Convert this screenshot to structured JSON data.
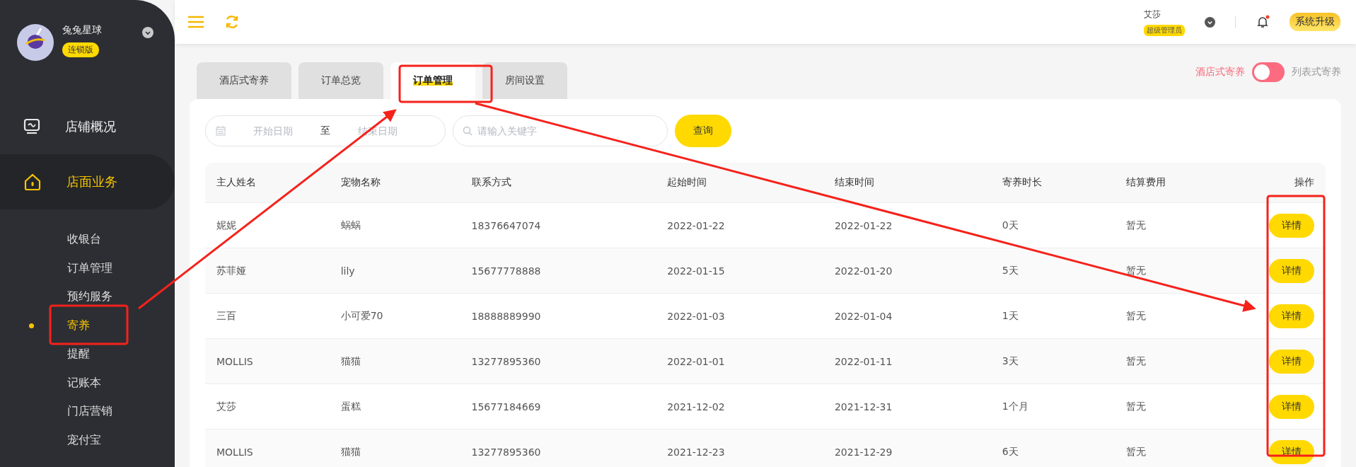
{
  "sidebar": {
    "store_name": "兔兔星球",
    "edition_badge": "连锁版",
    "menu": [
      {
        "label": "店铺概况",
        "selected": false
      },
      {
        "label": "店面业务",
        "selected": true,
        "children": [
          {
            "label": "收银台",
            "selected": false
          },
          {
            "label": "订单管理",
            "selected": false
          },
          {
            "label": "预约服务",
            "selected": false
          },
          {
            "label": "寄养",
            "selected": true
          },
          {
            "label": "提醒",
            "selected": false
          },
          {
            "label": "记账本",
            "selected": false
          },
          {
            "label": "门店营销",
            "selected": false
          },
          {
            "label": "宠付宝",
            "selected": false
          }
        ]
      }
    ]
  },
  "header": {
    "user_name": "艾莎",
    "role_badge": "超级管理员",
    "notification_unread": true,
    "upgrade_button": "系统升级"
  },
  "tabs": [
    {
      "label": "酒店式寄养",
      "selected": false
    },
    {
      "label": "订单总览",
      "selected": false
    },
    {
      "label": "订单管理",
      "selected": true
    },
    {
      "label": "房间设置",
      "selected": false
    }
  ],
  "view_switch": [
    {
      "label": "酒店式寄养",
      "selected": true
    },
    {
      "label": "列表式寄养",
      "selected": false
    }
  ],
  "filters": {
    "start_placeholder": "开始日期",
    "range_separator": "至",
    "end_placeholder": "结束日期",
    "search_placeholder": "请输入关键字",
    "query_button": "查询"
  },
  "table": {
    "columns": [
      "主人姓名",
      "宠物名称",
      "联系方式",
      "起始时间",
      "结束时间",
      "寄养时长",
      "结算费用",
      "操作"
    ],
    "rows": [
      {
        "cells": [
          "妮妮",
          "蜗蜗",
          "18376647074",
          "2022-01-22",
          "2022-01-22",
          "0天",
          "暂无"
        ],
        "action": "详情"
      },
      {
        "cells": [
          "苏菲娅",
          "lily",
          "15677778888",
          "2022-01-15",
          "2022-01-20",
          "5天",
          "暂无"
        ],
        "action": "详情"
      },
      {
        "cells": [
          "三百",
          "小可爱70",
          "18888889990",
          "2022-01-03",
          "2022-01-04",
          "1天",
          "暂无"
        ],
        "action": "详情"
      },
      {
        "cells": [
          "MOLLIS",
          "猫猫",
          "13277895360",
          "2022-01-01",
          "2022-01-11",
          "3天",
          "暂无"
        ],
        "action": "详情"
      },
      {
        "cells": [
          "艾莎",
          "蛋糕",
          "15677184669",
          "2021-12-02",
          "2021-12-31",
          "1个月",
          "暂无"
        ],
        "action": "详情"
      },
      {
        "cells": [
          "MOLLIS",
          "猫猫",
          "13277895360",
          "2021-12-23",
          "2021-12-29",
          "6天",
          "暂无"
        ],
        "action": "详情"
      }
    ]
  }
}
